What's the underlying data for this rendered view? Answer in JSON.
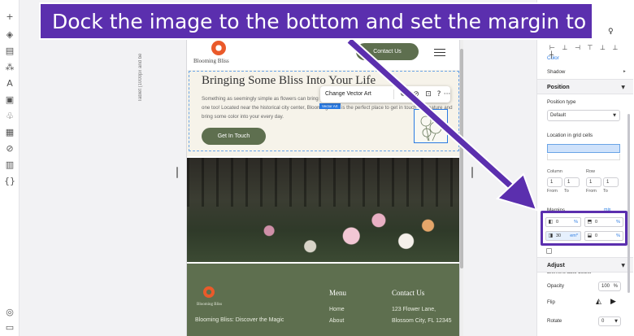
{
  "app": {
    "breakpoint_label": "Tablet (1000px and be"
  },
  "left_toolbar": {
    "icons": [
      "plus-icon",
      "layers-icon",
      "pages-icon",
      "apps-icon",
      "text-icon",
      "media-icon",
      "business-icon",
      "table-icon",
      "code-icon",
      "cms-icon",
      "brackets-icon",
      "help-icon",
      "comment-icon"
    ]
  },
  "site": {
    "logo_name": "Blooming Bliss",
    "header_button": "Contact Us",
    "hero_title": "Bringing Some Bliss Into Your Life",
    "hero_text": "Something as seemingly simple as flowers can bring so much magic to any special occasion, or every mundane one too! Located near the historical city center, Blooming Bliss is the perfect place to get in touch with nature and bring some color into your every day.",
    "hero_button": "Get In Touch",
    "vector_art_tag": "Vector Art",
    "footer": {
      "logo_name": "Blooming Bliss",
      "tagline": "Blooming Bliss: Discover the Magic",
      "menu_heading": "Menu",
      "menu_items": [
        "Home",
        "About"
      ],
      "contact_heading": "Contact Us",
      "contact_lines": [
        "123 Flower Lane,",
        "Blossom City, FL 12345"
      ]
    }
  },
  "floating_toolbar": {
    "change_label": "Change Vector Art",
    "icons": [
      "settings-icon",
      "link-icon",
      "crop-icon",
      "help-icon",
      "more-icon"
    ],
    "help_glyph": "?",
    "more_glyph": "···"
  },
  "panel": {
    "color_label": "Color",
    "shadow_label": "Shadow",
    "position_heading": "Position",
    "position_type_label": "Position type",
    "position_type_value": "Default",
    "location_label": "Location in grid cells",
    "column_label": "Column",
    "row_label": "Row",
    "col_from": "1",
    "col_to": "1",
    "row_from": "1",
    "row_to": "1",
    "from_label": "From",
    "to_label": "To",
    "margins_label": "Margins",
    "margins_unit": "mix",
    "margins": {
      "left": {
        "value": "0",
        "unit": "%"
      },
      "top": {
        "value": "0",
        "unit": "%"
      },
      "right": {
        "value": "30",
        "unit": "em*"
      },
      "bottom": {
        "value": "0",
        "unit": "%"
      }
    },
    "auto_docks_label": "Element auto docks",
    "adjust_heading": "Adjust",
    "opacity_label": "Opacity",
    "opacity_value": "100",
    "opacity_unit": "%",
    "flip_label": "Flip",
    "rotate_label": "Rotate",
    "rotate_value": "0"
  },
  "instruction": "Dock the image to the bottom and set the margin to 0",
  "colors": {
    "accent": "#5b2fae",
    "brand_green": "#5e6f4f",
    "selection": "#2a7ae2"
  }
}
